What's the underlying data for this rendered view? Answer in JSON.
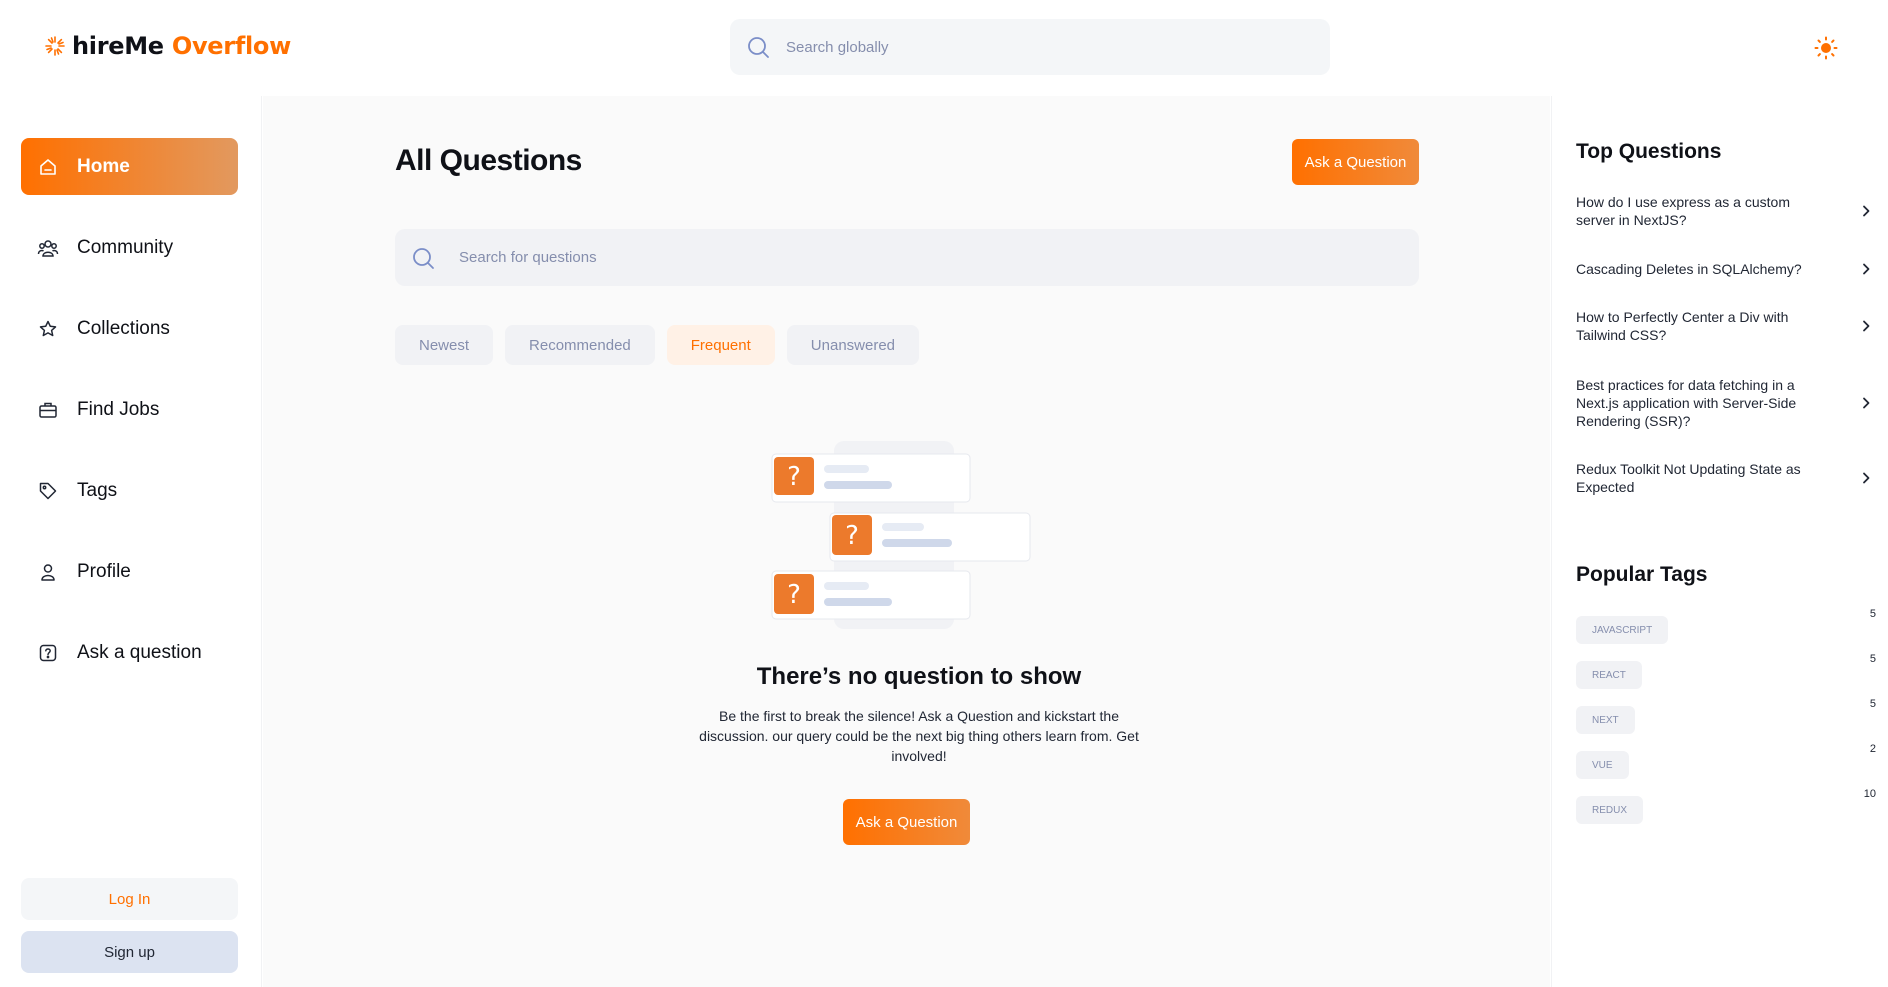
{
  "header": {
    "logo_main": "hireMe",
    "logo_accent": "Overflow",
    "search_placeholder": "Search globally",
    "theme_icon": "sun-icon"
  },
  "sidebar": {
    "items": [
      {
        "label": "Home",
        "icon": "home-icon",
        "active": true
      },
      {
        "label": "Community",
        "icon": "users-icon",
        "active": false
      },
      {
        "label": "Collections",
        "icon": "star-icon",
        "active": false
      },
      {
        "label": "Find Jobs",
        "icon": "briefcase-icon",
        "active": false
      },
      {
        "label": "Tags",
        "icon": "tag-icon",
        "active": false
      },
      {
        "label": "Profile",
        "icon": "user-icon",
        "active": false
      },
      {
        "label": "Ask a question",
        "icon": "question-icon",
        "active": false
      }
    ],
    "login_label": "Log In",
    "signup_label": "Sign up"
  },
  "main": {
    "title": "All Questions",
    "ask_button": "Ask a Question",
    "search_placeholder": "Search for questions",
    "filters": [
      {
        "label": "Newest",
        "active": false
      },
      {
        "label": "Recommended",
        "active": false
      },
      {
        "label": "Frequent",
        "active": true
      },
      {
        "label": "Unanswered",
        "active": false
      }
    ],
    "empty_state": {
      "title": "There’s no question to show",
      "description": "Be the first to break the silence! Ask a Question and kickstart the discussion. our query could be the next big thing others learn from. Get involved!",
      "button": "Ask a Question"
    }
  },
  "rightbar": {
    "top_questions_title": "Top Questions",
    "top_questions": [
      "How do I use express as a custom server in NextJS?",
      "Cascading Deletes in SQLAlchemy?",
      "How to Perfectly Center a Div with Tailwind CSS?",
      "Best practices for data fetching in a Next.js application with Server-Side Rendering (SSR)?",
      "Redux Toolkit Not Updating State as Expected"
    ],
    "popular_tags_title": "Popular Tags",
    "popular_tags": [
      {
        "name": "JAVASCRIPT",
        "count": "5"
      },
      {
        "name": "REACT",
        "count": "5"
      },
      {
        "name": "NEXT",
        "count": "5"
      },
      {
        "name": "VUE",
        "count": "2"
      },
      {
        "name": "REDUX",
        "count": "10"
      }
    ]
  },
  "colors": {
    "primary": "#ff7000",
    "muted": "#858ead"
  }
}
